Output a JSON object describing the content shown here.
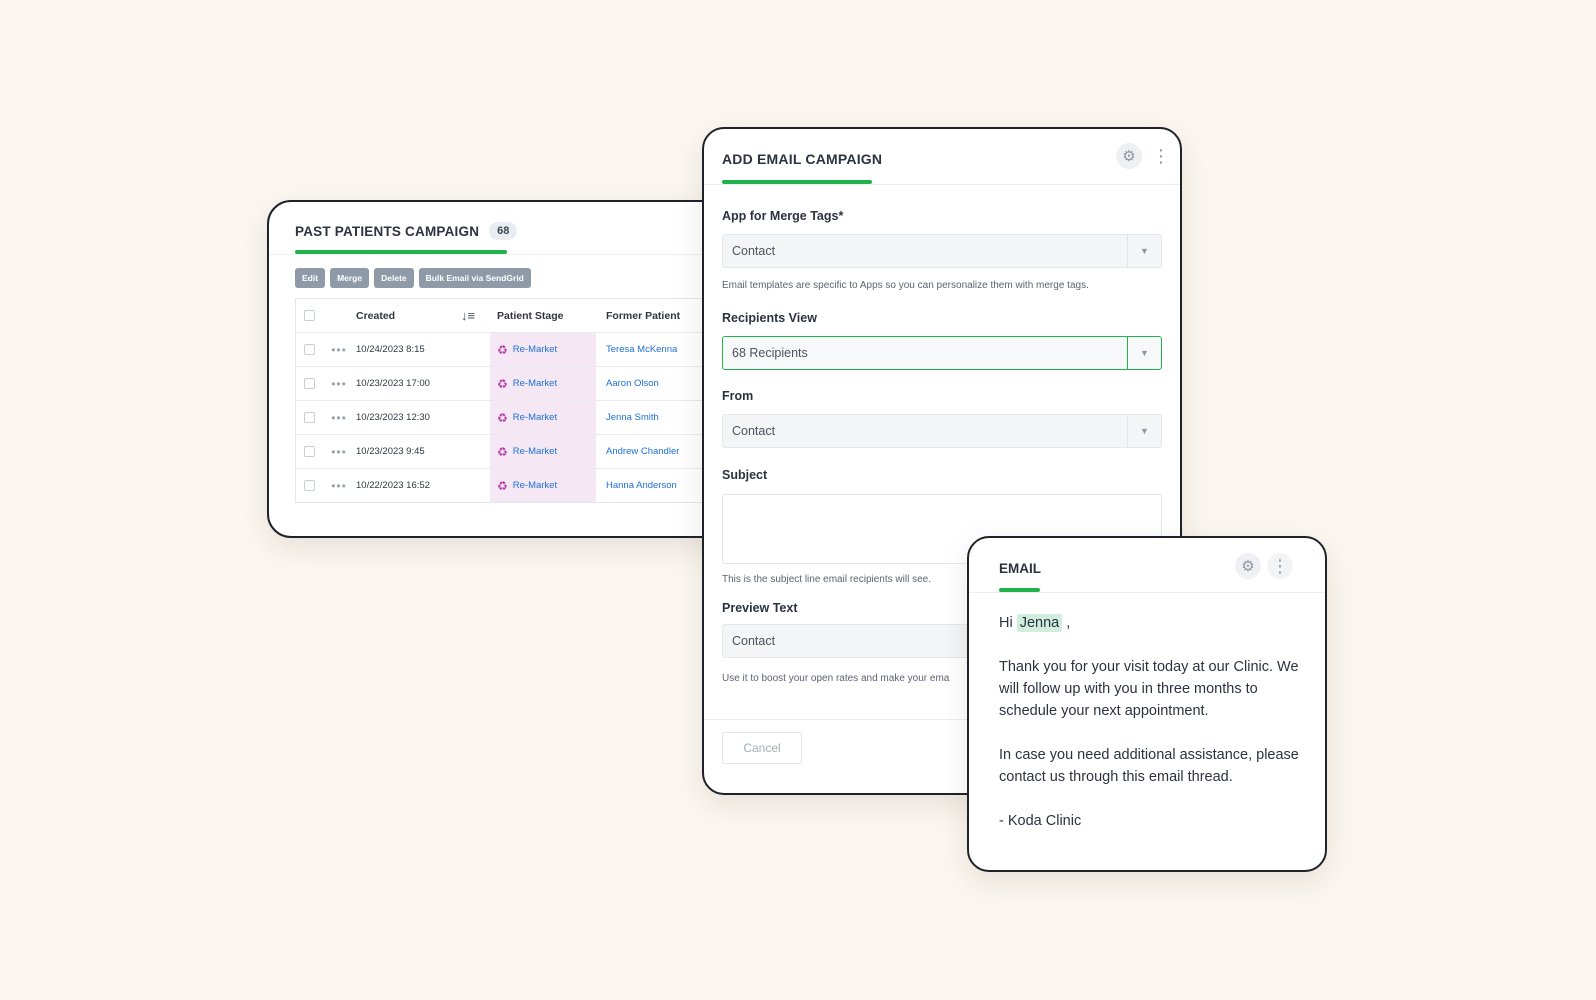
{
  "table_card": {
    "title": "PAST PATIENTS CAMPAIGN",
    "count": "68",
    "toolbar": [
      "Edit",
      "Merge",
      "Delete",
      "Bulk Email via SendGrid"
    ],
    "columns": {
      "created": "Created",
      "sort_icon": "↓≡",
      "stage": "Patient Stage",
      "former": "Former Patient"
    },
    "rows": [
      {
        "created": "10/24/2023 8:15",
        "stage": "Re-Market",
        "former": "Teresa McKenna"
      },
      {
        "created": "10/23/2023 17:00",
        "stage": "Re-Market",
        "former": "Aaron Olson"
      },
      {
        "created": "10/23/2023 12:30",
        "stage": "Re-Market",
        "former": "Jenna Smith"
      },
      {
        "created": "10/23/2023 9:45",
        "stage": "Re-Market",
        "former": "Andrew Chandler"
      },
      {
        "created": "10/22/2023 16:52",
        "stage": "Re-Market",
        "former": "Hanna Anderson"
      }
    ],
    "row_dots": "•••",
    "stage_icon": "♻"
  },
  "form_card": {
    "title": "ADD EMAIL CAMPAIGN",
    "gear_icon": "⚙",
    "more_icon": "⋮",
    "app_label": "App for Merge Tags*",
    "app_value": "Contact",
    "app_hint": "Email templates are specific to Apps so you can personalize them with merge tags.",
    "recipients_label": "Recipients View",
    "recipients_value": "68 Recipients",
    "from_label": "From",
    "from_value": "Contact",
    "subject_label": "Subject",
    "subject_hint": "This is the subject line email recipients will see.",
    "preview_label": "Preview Text",
    "preview_value": "Contact",
    "preview_hint": "Use it to boost your open rates and make your ema",
    "cancel_label": "Cancel",
    "dropdown_arrow": "▼"
  },
  "email_card": {
    "title": "EMAIL",
    "gear_icon": "⚙",
    "more_icon": "⋮",
    "greeting_prefix": "Hi",
    "merge_name": "Jenna",
    "greeting_suffix": ",",
    "paragraph1": "Thank you for your visit today at our Clinic. We will follow up with you in three months to schedule your next appointment.",
    "paragraph2": "In case you need additional assistance, please contact us through this email thread.",
    "signature": "- Koda Clinic"
  },
  "colors": {
    "accent": "#22b24c",
    "link": "#1e6fd6",
    "stage_bg": "#f5e8f4",
    "background": "#fbf6f0"
  }
}
